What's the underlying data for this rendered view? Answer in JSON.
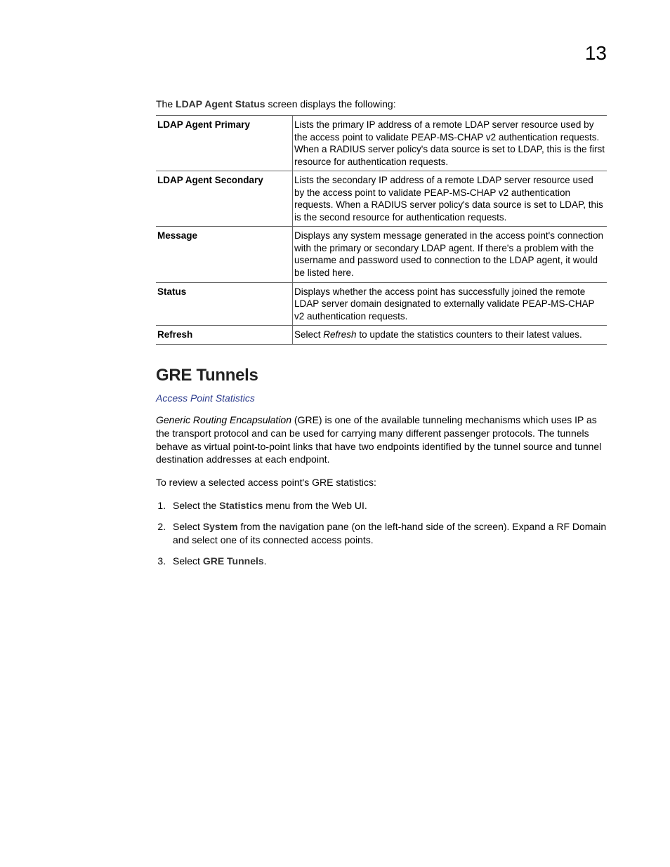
{
  "chapter_number": "13",
  "intro": {
    "prefix": "The ",
    "bold": "LDAP Agent Status",
    "suffix": " screen displays the following:"
  },
  "table": {
    "rows": [
      {
        "label": "LDAP Agent Primary",
        "desc": "Lists the primary IP address of a remote LDAP server resource used by the access point to validate PEAP-MS-CHAP v2 authentication requests. When a RADIUS server policy's data source is set to LDAP, this is the first resource for authentication requests."
      },
      {
        "label": "LDAP Agent Secondary",
        "desc": "Lists the secondary IP address of a remote LDAP server resource used by the access point to validate PEAP-MS-CHAP v2 authentication requests. When a RADIUS server policy's data source is set to LDAP, this is the second resource for authentication requests."
      },
      {
        "label": "Message",
        "desc": "Displays any system message generated in the access point's connection with the primary or secondary LDAP agent. If there's a problem with the username and password used to connection to the LDAP agent, it would be listed here."
      },
      {
        "label": "Status",
        "desc": "Displays whether the access point has successfully joined the remote LDAP server domain designated to externally validate PEAP-MS-CHAP v2 authentication requests."
      },
      {
        "label": "Refresh",
        "desc_prefix": "Select ",
        "desc_italic": "Refresh",
        "desc_suffix": " to update the statistics counters to their latest values."
      }
    ]
  },
  "section": {
    "heading": "GRE Tunnels",
    "breadcrumb": "Access Point Statistics",
    "para1_italic": "Generic Routing Encapsulation",
    "para1_rest": " (GRE) is one of the available tunneling mechanisms which uses IP as the transport protocol and can be used for carrying many different passenger protocols. The tunnels behave as virtual point-to-point links that have two endpoints identified by the tunnel source and tunnel destination addresses at each endpoint.",
    "para2": "To review a selected access point's GRE statistics:",
    "steps": [
      {
        "pre": "Select the ",
        "bold": "Statistics",
        "post": " menu from the Web UI."
      },
      {
        "pre": "Select ",
        "bold": "System",
        "post": " from the navigation pane (on the left-hand side of the screen). Expand a RF Domain and select one of its connected access points."
      },
      {
        "pre": "Select ",
        "bold": "GRE Tunnels",
        "post": "."
      }
    ]
  }
}
